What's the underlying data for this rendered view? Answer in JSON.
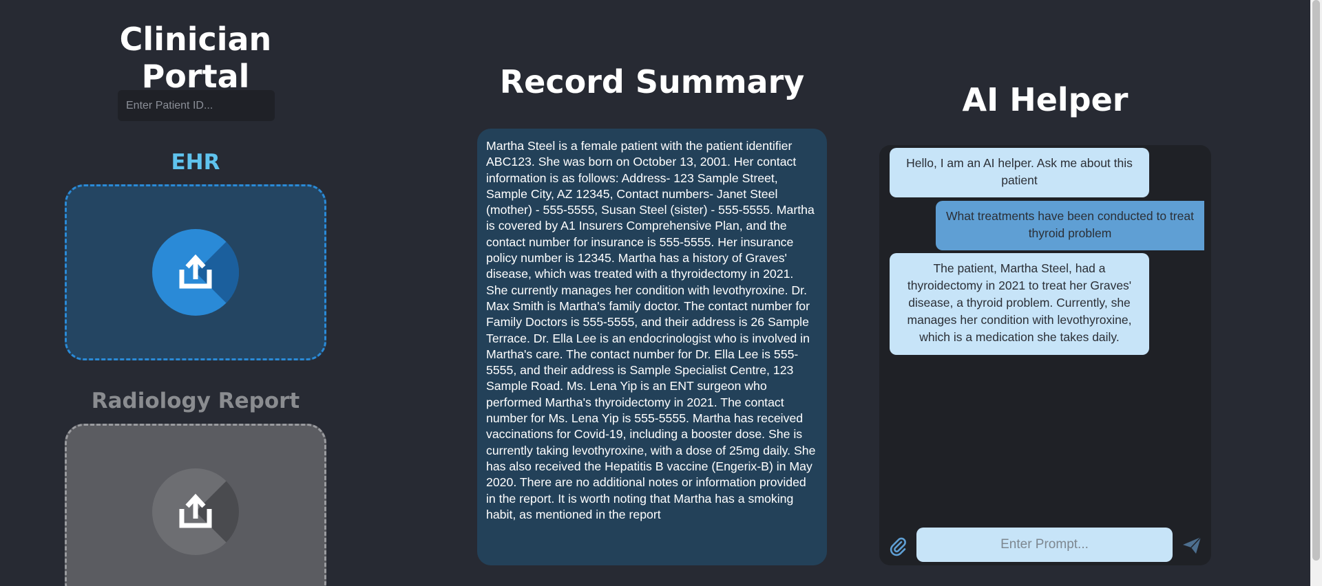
{
  "left": {
    "title": "Clinician Portal",
    "patient_id_placeholder": "Enter Patient ID...",
    "ehr_label": "EHR",
    "radiology_label": "Radiology Report"
  },
  "summary": {
    "title": "Record Summary",
    "text": "Martha Steel is a female patient with the patient identifier ABC123. She was born on October 13, 2001. Her contact information is as follows: Address- 123 Sample Street, Sample City, AZ 12345, Contact numbers- Janet Steel (mother) - 555-5555, Susan Steel (sister) - 555-5555. Martha is covered by A1 Insurers Comprehensive Plan, and the contact number for insurance is 555-5555. Her insurance policy number is 12345. Martha has a history of Graves' disease, which was treated with a thyroidectomy in 2021. She currently manages her condition with levothyroxine. Dr. Max Smith is Martha's family doctor. The contact number for Family Doctors is 555-5555, and their address is 26 Sample Terrace. Dr. Ella Lee is an endocrinologist who is involved in Martha's care. The contact number for Dr. Ella Lee is 555-5555, and their address is Sample Specialist Centre, 123 Sample Road. Ms. Lena Yip is an ENT surgeon who performed Martha's thyroidectomy in 2021. The contact number for Ms. Lena Yip is 555-5555. Martha has received vaccinations for Covid-19, including a booster dose. She is currently taking levothyroxine, with a dose of 25mg daily. She has also received the Hepatitis B vaccine (Engerix-B) in May 2020. There are no additional notes or information provided in the report. It is worth noting that Martha has a smoking habit, as mentioned in the report"
  },
  "helper": {
    "title": "AI Helper",
    "messages": [
      {
        "role": "ai",
        "text": "Hello, I am an AI helper. Ask me about this patient"
      },
      {
        "role": "user",
        "text": "What treatments have been conducted to treat thyroid problem"
      },
      {
        "role": "ai",
        "text": "The patient, Martha Steel, had a thyroidectomy in 2021 to treat her Graves' disease, a thyroid problem. Currently, she manages her condition with levothyroxine, which is a medication she takes daily."
      }
    ],
    "prompt_placeholder": "Enter Prompt..."
  },
  "icons": {
    "upload": "upload-icon",
    "attach": "paperclip-icon",
    "send": "send-icon"
  },
  "colors": {
    "background": "#272a33",
    "ehr_accent": "#2a8ad7",
    "ehr_label": "#5fc3ee",
    "bubble_ai": "#c7e4f8",
    "bubble_user": "#5f9fd4",
    "summary_card": "#234159"
  }
}
